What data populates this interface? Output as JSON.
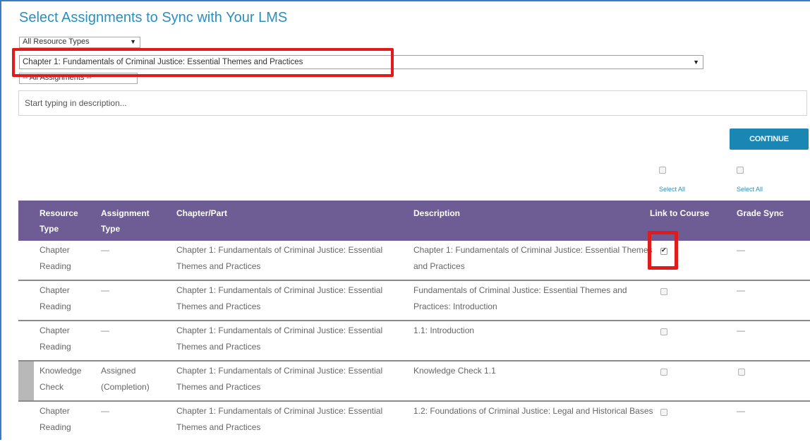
{
  "page": {
    "title": "Select Assignments to Sync with Your LMS"
  },
  "filters": {
    "resource_type": "All Resource Types",
    "chapter": "Chapter 1: Fundamentals of Criminal Justice: Essential Themes and Practices",
    "assignments": "-- All Assignments --",
    "description_placeholder": "Start typing in description..."
  },
  "actions": {
    "continue_label": "CONTINUE",
    "select_all_label": "Select All"
  },
  "colors": {
    "header_bg": "#6e5c95",
    "accent": "#1a86b4",
    "highlight": "#e01b1b"
  },
  "table": {
    "columns": {
      "resource_type": "Resource Type",
      "assignment_type": "Assignment Type",
      "chapter_part": "Chapter/Part",
      "description": "Description",
      "link_to_course": "Link to Course",
      "grade_sync": "Grade Sync"
    },
    "rows": [
      {
        "resource_type": "Chapter Reading",
        "assignment_type": "—",
        "chapter_part": "Chapter 1: Fundamentals of Criminal Justice: Essential Themes and Practices",
        "description": "Chapter 1: Fundamentals of Criminal Justice: Essential Themes and Practices",
        "link_checked": true,
        "grade_sync": "—"
      },
      {
        "resource_type": "Chapter Reading",
        "assignment_type": "—",
        "chapter_part": "Chapter 1: Fundamentals of Criminal Justice: Essential Themes and Practices",
        "description": "Fundamentals of Criminal Justice: Essential Themes and Practices: Introduction",
        "link_checked": false,
        "grade_sync": "—"
      },
      {
        "resource_type": "Chapter Reading",
        "assignment_type": "—",
        "chapter_part": "Chapter 1: Fundamentals of Criminal Justice: Essential Themes and Practices",
        "description": "1.1: Introduction",
        "link_checked": false,
        "grade_sync": "—"
      },
      {
        "resource_type": "Knowledge Check",
        "assignment_type": "Assigned (Completion)",
        "chapter_part": "Chapter 1: Fundamentals of Criminal Justice: Essential Themes and Practices",
        "description": "Knowledge Check 1.1",
        "link_checked": false,
        "grade_sync": "checkbox"
      },
      {
        "resource_type": "Chapter Reading",
        "assignment_type": "—",
        "chapter_part": "Chapter 1: Fundamentals of Criminal Justice: Essential Themes and Practices",
        "description": "1.2: Foundations of Criminal Justice: Legal and Historical Bases",
        "link_checked": false,
        "grade_sync": "—"
      }
    ]
  }
}
